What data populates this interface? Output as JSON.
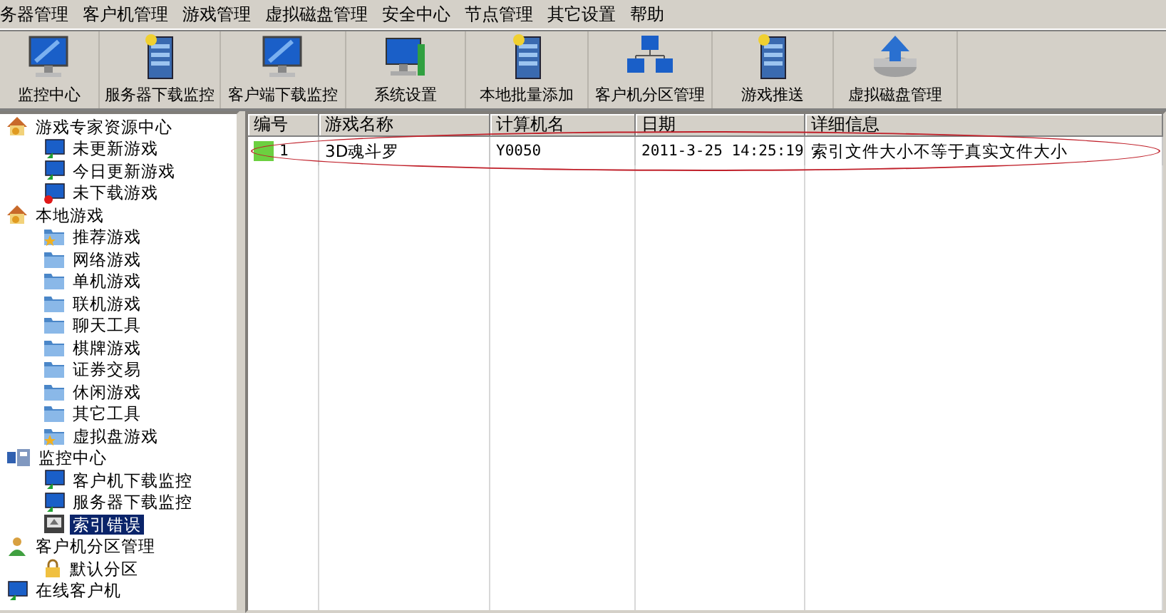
{
  "menu": [
    "务器管理",
    "客户机管理",
    "游戏管理",
    "虚拟磁盘管理",
    "安全中心",
    "节点管理",
    "其它设置",
    "帮助"
  ],
  "toolbar": [
    {
      "label": "监控中心",
      "kind": "monitor"
    },
    {
      "label": "服务器下载监控",
      "kind": "server"
    },
    {
      "label": "客户端下载监控",
      "kind": "monitor"
    },
    {
      "label": "系统设置",
      "kind": "settings"
    },
    {
      "label": "本地批量添加",
      "kind": "server"
    },
    {
      "label": "客户机分区管理",
      "kind": "network"
    },
    {
      "label": "游戏推送",
      "kind": "server"
    },
    {
      "label": "虚拟磁盘管理",
      "kind": "disk"
    }
  ],
  "tree": [
    {
      "label": "游戏专家资源中心",
      "kind": "house",
      "selected": false,
      "children": [
        {
          "label": "未更新游戏",
          "kind": "monitor",
          "selected": false
        },
        {
          "label": "今日更新游戏",
          "kind": "monitor",
          "selected": false
        },
        {
          "label": "未下载游戏",
          "kind": "monitor-error",
          "selected": false
        }
      ]
    },
    {
      "label": "本地游戏",
      "kind": "house",
      "selected": false,
      "children": [
        {
          "label": "推荐游戏",
          "kind": "folder-star",
          "selected": false
        },
        {
          "label": "网络游戏",
          "kind": "folder",
          "selected": false
        },
        {
          "label": "单机游戏",
          "kind": "folder",
          "selected": false
        },
        {
          "label": "联机游戏",
          "kind": "folder",
          "selected": false
        },
        {
          "label": "聊天工具",
          "kind": "folder",
          "selected": false
        },
        {
          "label": "棋牌游戏",
          "kind": "folder",
          "selected": false
        },
        {
          "label": "证券交易",
          "kind": "folder",
          "selected": false
        },
        {
          "label": "休闲游戏",
          "kind": "folder",
          "selected": false
        },
        {
          "label": "其它工具",
          "kind": "folder",
          "selected": false
        },
        {
          "label": "虚拟盘游戏",
          "kind": "folder-star",
          "selected": false
        }
      ]
    },
    {
      "label": "监控中心",
      "kind": "network",
      "selected": false,
      "children": [
        {
          "label": "客户机下载监控",
          "kind": "monitor",
          "selected": false
        },
        {
          "label": "服务器下载监控",
          "kind": "monitor",
          "selected": false
        },
        {
          "label": "索引错误",
          "kind": "disk",
          "selected": true
        }
      ]
    },
    {
      "label": "客户机分区管理",
      "kind": "people",
      "selected": false,
      "children": [
        {
          "label": "默认分区",
          "kind": "lock",
          "selected": false
        }
      ]
    },
    {
      "label": "在线客户机",
      "kind": "monitor",
      "selected": false
    }
  ],
  "table": {
    "columns": [
      "编号",
      "游戏名称",
      "计算机名",
      "日期",
      "详细信息"
    ],
    "rows": [
      {
        "cells": [
          "1",
          "3D魂斗罗",
          "Y0050",
          "2011-3-25 14:25:19",
          "索引文件大小不等于真实文件大小"
        ]
      }
    ]
  }
}
